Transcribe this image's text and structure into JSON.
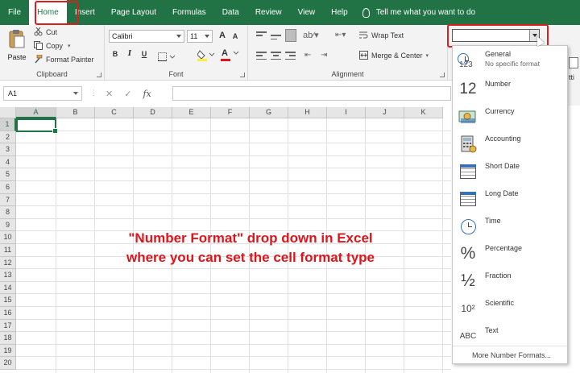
{
  "menu": {
    "tabs": [
      "File",
      "Home",
      "Insert",
      "Page Layout",
      "Formulas",
      "Data",
      "Review",
      "View",
      "Help"
    ],
    "active_tab": "Home",
    "tell_me": "Tell me what you want to do"
  },
  "ribbon": {
    "clipboard": {
      "paste": "Paste",
      "cut": "Cut",
      "copy": "Copy",
      "format_painter": "Format Painter",
      "label": "Clipboard"
    },
    "font": {
      "font_name": "Calibri",
      "font_size": "11",
      "bold": "B",
      "italic": "I",
      "underline": "U",
      "grow": "A",
      "shrink": "A",
      "font_color_letter": "A",
      "label": "Font"
    },
    "alignment": {
      "wrap_text": "Wrap Text",
      "merge_center": "Merge & Center",
      "label": "Alignment"
    },
    "number_format": {
      "value": ""
    },
    "edge_text": "tti"
  },
  "formula_bar": {
    "name_box": "A1",
    "cancel": "✕",
    "enter": "✓",
    "fx": "fx",
    "content": ""
  },
  "grid": {
    "columns": [
      "A",
      "B",
      "C",
      "D",
      "E",
      "F",
      "G",
      "H",
      "I",
      "J",
      "K"
    ],
    "rows": [
      "1",
      "2",
      "3",
      "4",
      "5",
      "6",
      "7",
      "8",
      "9",
      "10",
      "11",
      "12",
      "13",
      "14",
      "15",
      "16",
      "17",
      "18",
      "19",
      "20"
    ],
    "selected_cell": "A1"
  },
  "caption": {
    "line1": "\"Number Format\" drop down in Excel",
    "line2": "where you can set the cell format type"
  },
  "dropdown": {
    "items": [
      {
        "label": "General",
        "sub": "No specific format",
        "icon": "clock-123-icon",
        "glyph": "123"
      },
      {
        "label": "Number",
        "icon": "number-12-icon",
        "glyph": "12"
      },
      {
        "label": "Currency",
        "icon": "currency-icon",
        "glyph": ""
      },
      {
        "label": "Accounting",
        "icon": "accounting-icon",
        "glyph": ""
      },
      {
        "label": "Short Date",
        "icon": "calendar-icon",
        "glyph": ""
      },
      {
        "label": "Long Date",
        "icon": "calendar-icon",
        "glyph": ""
      },
      {
        "label": "Time",
        "icon": "clock-icon",
        "glyph": ""
      },
      {
        "label": "Percentage",
        "icon": "percent-icon",
        "glyph": "%"
      },
      {
        "label": "Fraction",
        "icon": "fraction-icon",
        "glyph": "½"
      },
      {
        "label": "Scientific",
        "icon": "scientific-icon",
        "glyph": "10²"
      },
      {
        "label": "Text",
        "icon": "text-abc-icon",
        "glyph": "ABC"
      }
    ],
    "more": "More Number Formats..."
  },
  "colors": {
    "excel_green": "#217346",
    "highlight_red": "#d9201f",
    "caption_red": "#e0141b",
    "icon_blue": "#3a6fb4"
  }
}
